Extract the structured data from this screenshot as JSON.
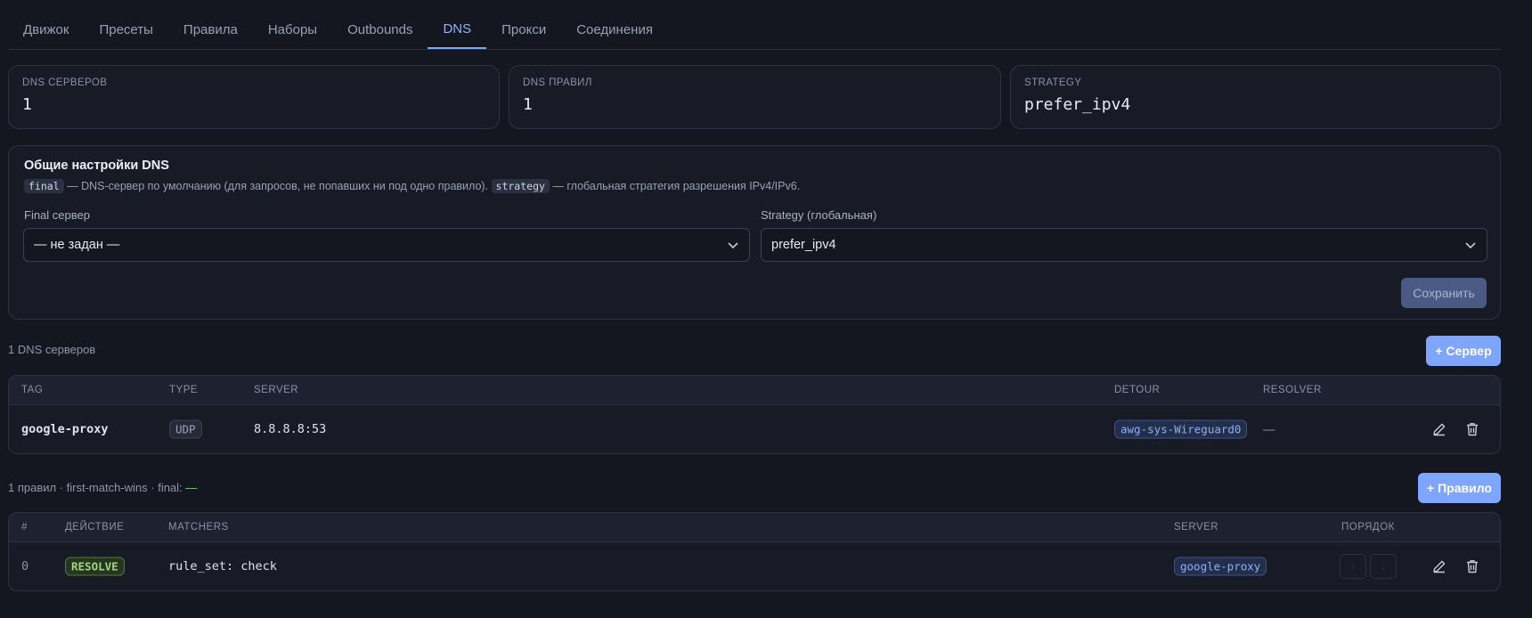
{
  "tabs": [
    {
      "label": "Движок"
    },
    {
      "label": "Пресеты"
    },
    {
      "label": "Правила"
    },
    {
      "label": "Наборы"
    },
    {
      "label": "Outbounds"
    },
    {
      "label": "DNS",
      "active": true
    },
    {
      "label": "Прокси"
    },
    {
      "label": "Соединения"
    }
  ],
  "stats": {
    "servers": {
      "label": "DNS серверов",
      "value": "1"
    },
    "rules": {
      "label": "DNS правил",
      "value": "1"
    },
    "strategy": {
      "label": "Strategy",
      "value": "prefer_ipv4"
    }
  },
  "settings": {
    "title": "Общие настройки DNS",
    "chip_final": "final",
    "desc_final": " — DNS-сервер по умолчанию (для запросов, не попавших ни под одно правило). ",
    "chip_strategy": "strategy",
    "desc_strategy": " — глобальная стратегия разрешения IPv4/IPv6.",
    "final_label": "Final сервер",
    "final_value": "— не задан —",
    "strategy_label": "Strategy (глобальная)",
    "strategy_value": "prefer_ipv4",
    "save_label": "Сохранить"
  },
  "servers_section": {
    "summary": "1 DNS серверов",
    "add_label": "+ Сервер",
    "headers": {
      "tag": "Tag",
      "type": "Type",
      "server": "Server",
      "detour": "Detour",
      "resolver": "Resolver"
    },
    "rows": [
      {
        "tag": "google-proxy",
        "type": "UDP",
        "server": "8.8.8.8:53",
        "detour": "awg-sys-Wireguard0",
        "resolver": "—"
      }
    ]
  },
  "rules_section": {
    "summary": "1 правил · first-match-wins · final: ",
    "final_value": "—",
    "add_label": "+ Правило",
    "headers": {
      "num": "#",
      "action": "Действие",
      "matchers": "Matchers",
      "server": "Server",
      "order": "Порядок"
    },
    "rows": [
      {
        "num": "0",
        "action": "RESOLVE",
        "matchers": "rule_set: check",
        "server": "google-proxy",
        "up": "↑",
        "down": "↓"
      }
    ]
  },
  "colors": {
    "accent": "#7ea6ff",
    "background": "#141620",
    "card": "#181b26",
    "success": "#a4d47f"
  }
}
